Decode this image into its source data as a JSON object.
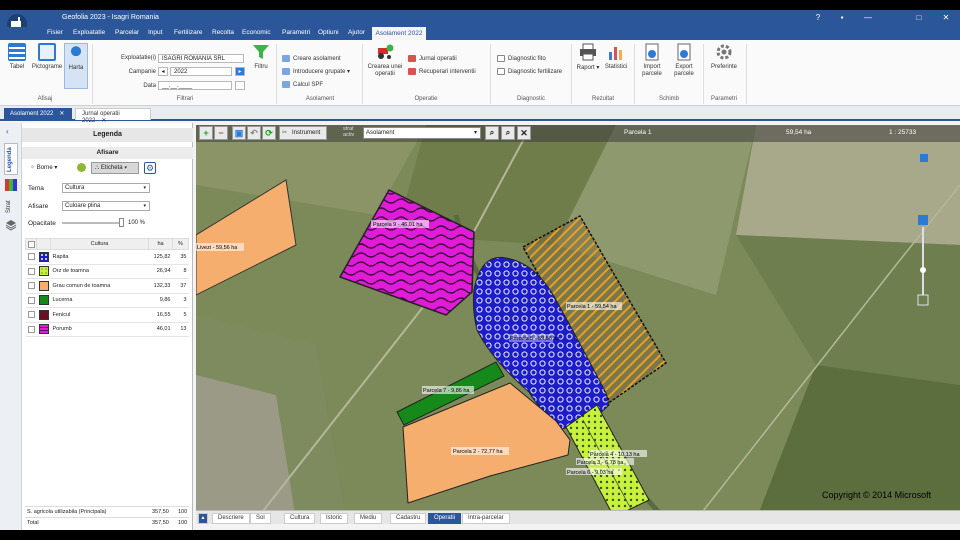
{
  "window": {
    "title": "Geofolia 2023 - Isagri Romania",
    "controls": [
      "?",
      "▪",
      "—",
      "□",
      "✕"
    ]
  },
  "menu": {
    "items": [
      "Fisier",
      "Exploatatie",
      "Parcelar",
      "Input",
      "Fertilizare",
      "Recolta",
      "Economic",
      "Parametri",
      "Optiuni",
      "Ajutor"
    ],
    "active": "Asolament 2022"
  },
  "ribbon": {
    "afisaj": {
      "label": "Afisaj",
      "tabel": "Tabel",
      "pictograme": "Pictograme",
      "harta": "Harta"
    },
    "filtrari": {
      "label": "Filtrari",
      "exploatatie_label": "Exploatatie(i)",
      "exploatatie_value": "ISAGRI ROMANIA SRL",
      "campanie_label": "Campanie",
      "campanie_value": "2022",
      "data_label": "Data",
      "data_value": "__.__.____",
      "filtru": "Filtru"
    },
    "asolament": {
      "label": "Asolament",
      "creare": "Creare asolament",
      "introducere": "Introducere grupate",
      "calcul": "Calcul SPF"
    },
    "operatie": {
      "label": "Operatie",
      "creare": "Crearea unei operatii",
      "jurnal": "Jurnal operatii",
      "recuperari": "Recuperari interventii"
    },
    "diagnostic": {
      "label": "Diagnostic",
      "fito": "Diagnostic fito",
      "fertilizare": "Diagnostic fertilizare"
    },
    "rezultat": {
      "label": "Rezultat",
      "raport": "Raport",
      "statistici": "Statistici"
    },
    "schimb": {
      "label": "Schimb",
      "import": "Import parcele",
      "export": "Export parcele"
    },
    "parametri": {
      "label": "Parametri",
      "preferinte": "Preferinte"
    }
  },
  "doc_tabs": [
    {
      "label": "Asolament 2022",
      "active": true
    },
    {
      "label": "Jurnal operatii 2022",
      "active": false
    }
  ],
  "side_tabs": [
    "Legenda",
    "Strat"
  ],
  "legend": {
    "title": "Legenda",
    "afisare_title": "Afisare",
    "borne": "Borne",
    "eticheta": "Eticheta",
    "tema_label": "Tema",
    "tema_value": "Cultura",
    "afisare_label": "Afisare",
    "afisare_value": "Culoare plina",
    "opacitate_label": "Opacitate",
    "opacitate_value": "100 %",
    "opacitate_level": 1.0,
    "headers": [
      "Cultura",
      "ha",
      "%"
    ],
    "rows": [
      {
        "name": "Rapita",
        "ha": "125,82",
        "pct": "35",
        "color": "#1c1cc8",
        "pattern": "dots"
      },
      {
        "name": "Orz de toamna",
        "ha": "26,94",
        "pct": "8",
        "color": "#c8f03c",
        "pattern": "dots"
      },
      {
        "name": "Grau comun de toamna",
        "ha": "132,33",
        "pct": "37",
        "color": "#f6ae6e",
        "pattern": "solid"
      },
      {
        "name": "Lucerna",
        "ha": "9,86",
        "pct": "3",
        "color": "#158a1a",
        "pattern": "solid"
      },
      {
        "name": "Fenicul",
        "ha": "16,55",
        "pct": "5",
        "color": "#6a0f26",
        "pattern": "solid"
      },
      {
        "name": "Porumb",
        "ha": "46,01",
        "pct": "13",
        "color": "#e01cd8",
        "pattern": "waves"
      }
    ],
    "footer": [
      {
        "label": "S. agricola utilizabila (Principala)",
        "ha": "357,50",
        "pct": "100"
      },
      {
        "label": "Total",
        "ha": "357,50",
        "pct": "100"
      }
    ]
  },
  "map": {
    "strat_label": "strat activ",
    "layer": "Asolament",
    "instrument": "Instrument",
    "selected_parcel": "Parcela 1",
    "selected_area": "59,54 ha",
    "scale": "1 : 25733",
    "copyright": "Copyright © 2014 Microsoft",
    "labels": {
      "p9": "Parcela 9 - 46,01 ha",
      "p1": "Parcela 1 - 59,54 ha",
      "pbig": "Parcela 5 - 59,56 ha",
      "pleft": "Livezi - 59,56 ha",
      "p7": "Parcela 7 - 9,86 ha",
      "p2": "Parcela 2 - 72,77 ha",
      "p4": "Parcela 4 - 10,13 ha",
      "p3": "Parcela 3 - 6,78 ha",
      "p6": "Parcela 6 - 9,03 ha"
    }
  },
  "bottom_tabs": [
    "Descriere",
    "Sol",
    "Cultura",
    "Istoric",
    "Mediu",
    "Cadastru",
    "Operatii",
    "Intra-parcelar"
  ],
  "bottom_active": "Operatii"
}
